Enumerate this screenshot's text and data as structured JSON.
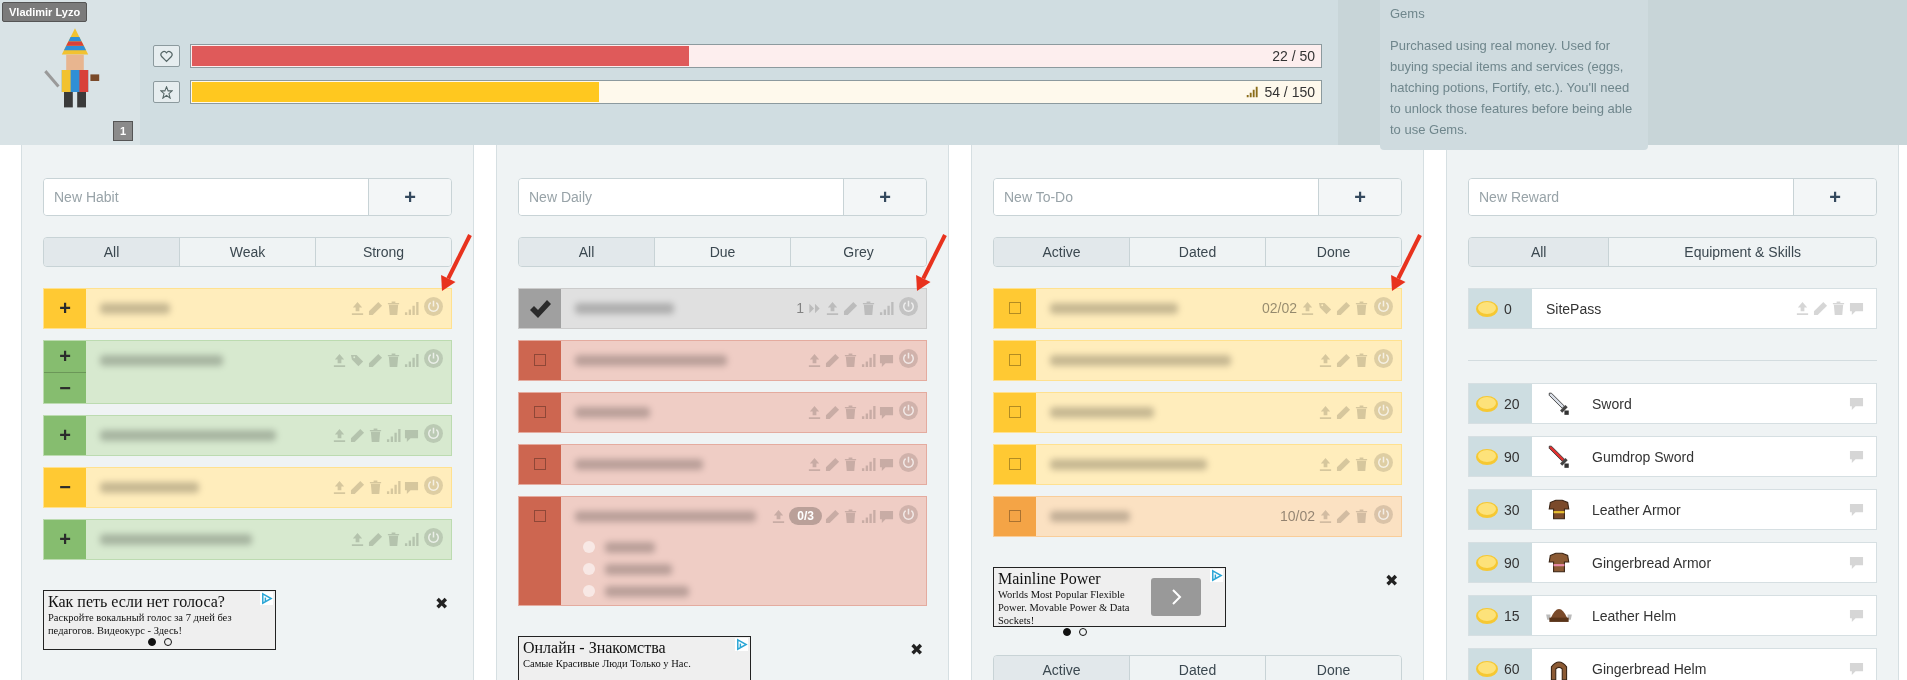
{
  "header": {
    "user_name": "Vladimir Lyzo",
    "level": "1",
    "bars": [
      {
        "kind": "health",
        "reading": "22 / 50",
        "level": 0.44
      },
      {
        "kind": "experience",
        "reading": "54 / 150",
        "level": 0.36
      }
    ],
    "tooltip": {
      "title": "Gems",
      "text": "Purchased using real money. Used for buying special items and services (eggs, hatching potions, Fortify, etc.). You'll need to unlock those features before being able to use Gems."
    }
  },
  "columns": [
    {
      "kind": "habits",
      "placeholder": "New Habit",
      "add_label": "+",
      "filters": [
        {
          "label": "All",
          "selected": true
        },
        {
          "label": "Weak",
          "selected": false
        },
        {
          "label": "Strong",
          "selected": false
        }
      ],
      "tasks": [
        {
          "color": "#ffc933",
          "buttons": [
            "+"
          ],
          "tags": false,
          "notes": false,
          "annotated": true
        },
        {
          "color": "#86bd6f",
          "buttons": [
            "+",
            "−"
          ],
          "tags": true,
          "notes": false
        },
        {
          "color": "#86bd6f",
          "buttons": [
            "+"
          ],
          "tags": false,
          "notes": true
        },
        {
          "color": "#ffc933",
          "buttons": [
            "−"
          ],
          "tags": false,
          "notes": true
        },
        {
          "color": "#86bd6f",
          "buttons": [
            "+"
          ],
          "tags": false,
          "notes": false
        }
      ],
      "ad": {
        "title": "Как петь если нет голоса?",
        "text": "Раскройте вокальный голос за 7 дней без педагогов. Видеокурс - Здесь!",
        "dots": [
          {
            "selected": true
          },
          {
            "selected": false
          }
        ],
        "close_label": "✖"
      }
    },
    {
      "kind": "dailies",
      "placeholder": "New Daily",
      "add_label": "+",
      "filters": [
        {
          "label": "All",
          "selected": true
        },
        {
          "label": "Due",
          "selected": false
        },
        {
          "label": "Grey",
          "selected": false
        }
      ],
      "tasks": [
        {
          "color": "#a0a0a0",
          "checked": true,
          "streak": "1",
          "tags": false,
          "notes": false,
          "annotated": true
        },
        {
          "color": "#cd6650",
          "checked": false,
          "tags": false,
          "notes": true
        },
        {
          "color": "#cd6650",
          "checked": false,
          "tags": false,
          "notes": true
        },
        {
          "color": "#cd6650",
          "checked": false,
          "tags": false,
          "notes": true
        },
        {
          "color": "#cd6650",
          "checked": false,
          "tags": false,
          "notes": true,
          "checklist_count": "0/3",
          "checklist": [
            {
              "checked": false
            },
            {
              "checked": false
            },
            {
              "checked": false
            }
          ]
        }
      ],
      "ad": {
        "title": "Онлайн - Знакомства",
        "text": "Самые Красивые Люди Только у Нас.",
        "close_label": "✖"
      }
    },
    {
      "kind": "todos",
      "placeholder": "New To-Do",
      "add_label": "+",
      "filters": [
        {
          "label": "Active",
          "selected": true
        },
        {
          "label": "Dated",
          "selected": false
        },
        {
          "label": "Done",
          "selected": false
        }
      ],
      "tasks": [
        {
          "color": "#ffc933",
          "checked": false,
          "date": "02/02",
          "tags": true,
          "notes": false,
          "annotated": true
        },
        {
          "color": "#ffc933",
          "checked": false,
          "tags": false,
          "notes": false
        },
        {
          "color": "#ffc933",
          "checked": false,
          "tags": false,
          "notes": false
        },
        {
          "color": "#ffc933",
          "checked": false,
          "tags": false,
          "notes": false
        },
        {
          "color": "#f4a446",
          "checked": false,
          "date": "10/02",
          "tags": false,
          "notes": false
        }
      ],
      "ad": {
        "title": "Mainline Power",
        "text": "Worlds Most Popular Flexible Power. Movable Power & Data Sockets!",
        "dots": [
          {
            "selected": true
          },
          {
            "selected": false
          }
        ],
        "next_button": true,
        "close_label": "✖"
      },
      "bottom_filters": [
        {
          "label": "Active",
          "selected": true
        },
        {
          "label": "Dated",
          "selected": false
        },
        {
          "label": "Done",
          "selected": false
        }
      ]
    },
    {
      "kind": "rewards",
      "placeholder": "New Reward",
      "add_label": "+",
      "filters": [
        {
          "label": "All",
          "selected": true
        },
        {
          "label": "Equipment & Skills",
          "selected": false
        }
      ],
      "custom": [
        {
          "price": "0",
          "name": "SitePass"
        }
      ],
      "gear": [
        {
          "price": "20",
          "name": "Sword"
        },
        {
          "price": "90",
          "name": "Gumdrop Sword"
        },
        {
          "price": "30",
          "name": "Leather Armor"
        },
        {
          "price": "90",
          "name": "Gingerbread Armor"
        },
        {
          "price": "15",
          "name": "Leather Helm"
        },
        {
          "price": "60",
          "name": "Gingerbread Helm"
        }
      ]
    }
  ]
}
